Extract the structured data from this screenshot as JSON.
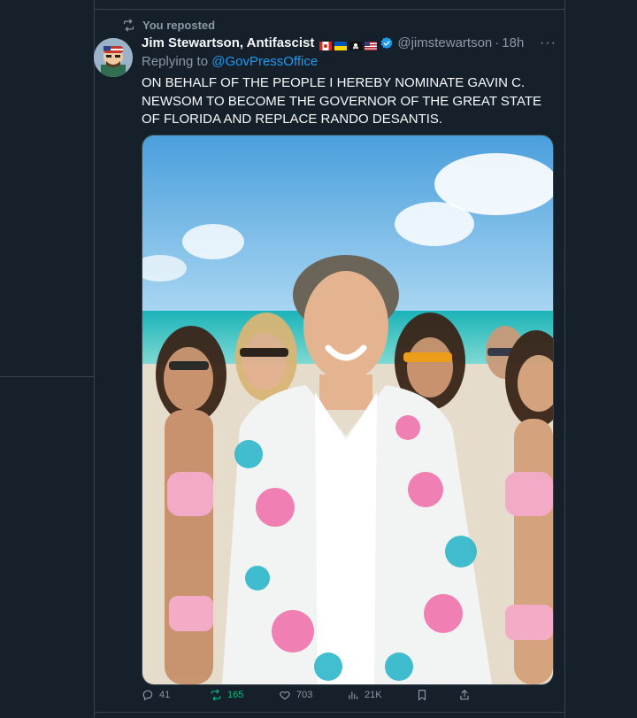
{
  "repost": {
    "icon": "repost-icon",
    "label": "You reposted"
  },
  "tweet": {
    "author_name": "Jim Stewartson, Antifascist",
    "flags": [
      "canada-flag",
      "ukraine-flag",
      "pirate-flag",
      "usa-flag"
    ],
    "verified": true,
    "handle": "@jimstewartson",
    "separator": "·",
    "time": "18h",
    "more_label": "···",
    "replying_prefix": "Replying to",
    "replying_handle": "@GovPressOffice",
    "text": "ON BEHALF OF THE PEOPLE I HEREBY NOMINATE GAVIN C. NEWSOM TO BECOME THE GOVERNOR OF THE GREAT STATE OF FLORIDA AND REPLACE RANDO DESANTIS."
  },
  "actions": {
    "replies": "41",
    "reposts": "165",
    "likes": "703",
    "views": "21K"
  },
  "colors": {
    "background": "#15202b",
    "accent": "#1d9bf0",
    "repost_active": "#00ba7c",
    "muted": "#8b98a5"
  }
}
